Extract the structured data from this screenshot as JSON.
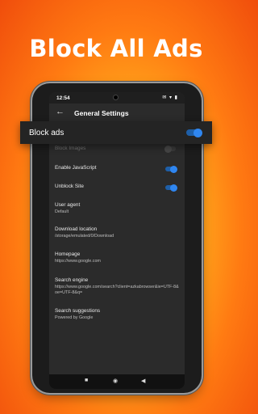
{
  "headline": "Block All Ads",
  "status_bar": {
    "time": "12:54",
    "icons": "✉ ▾ ▮"
  },
  "toolbar": {
    "title": "General Settings"
  },
  "callout": {
    "label": "Block ads",
    "toggle_on": true
  },
  "settings": {
    "block_images": {
      "title": "Block Images",
      "toggle_on": false
    },
    "enable_javascript": {
      "title": "Enable JavaScript",
      "toggle_on": true
    },
    "unblock_site": {
      "title": "Unblock Site",
      "toggle_on": true
    },
    "user_agent": {
      "title": "User agent",
      "value": "Default"
    },
    "download_location": {
      "title": "Download location",
      "value": "/storage/emulated/0/Download"
    },
    "homepage": {
      "title": "Homepage",
      "value": "https://www.google.com"
    },
    "search_engine": {
      "title": "Search engine",
      "value": "https://www.google.com/search?client=azkabrowser&ie=UTF-8&oe=UTF-8&q="
    },
    "search_suggestions": {
      "title": "Search suggestions",
      "value": "Powered by Google"
    }
  },
  "colors": {
    "accent": "#2f86f0",
    "background_warm": "#ff7a12",
    "screen": "#2b2b2b"
  },
  "icons": [
    "back-arrow-icon",
    "camera-icon",
    "signal-icon",
    "home-icon",
    "recents-icon",
    "back-nav-icon"
  ]
}
